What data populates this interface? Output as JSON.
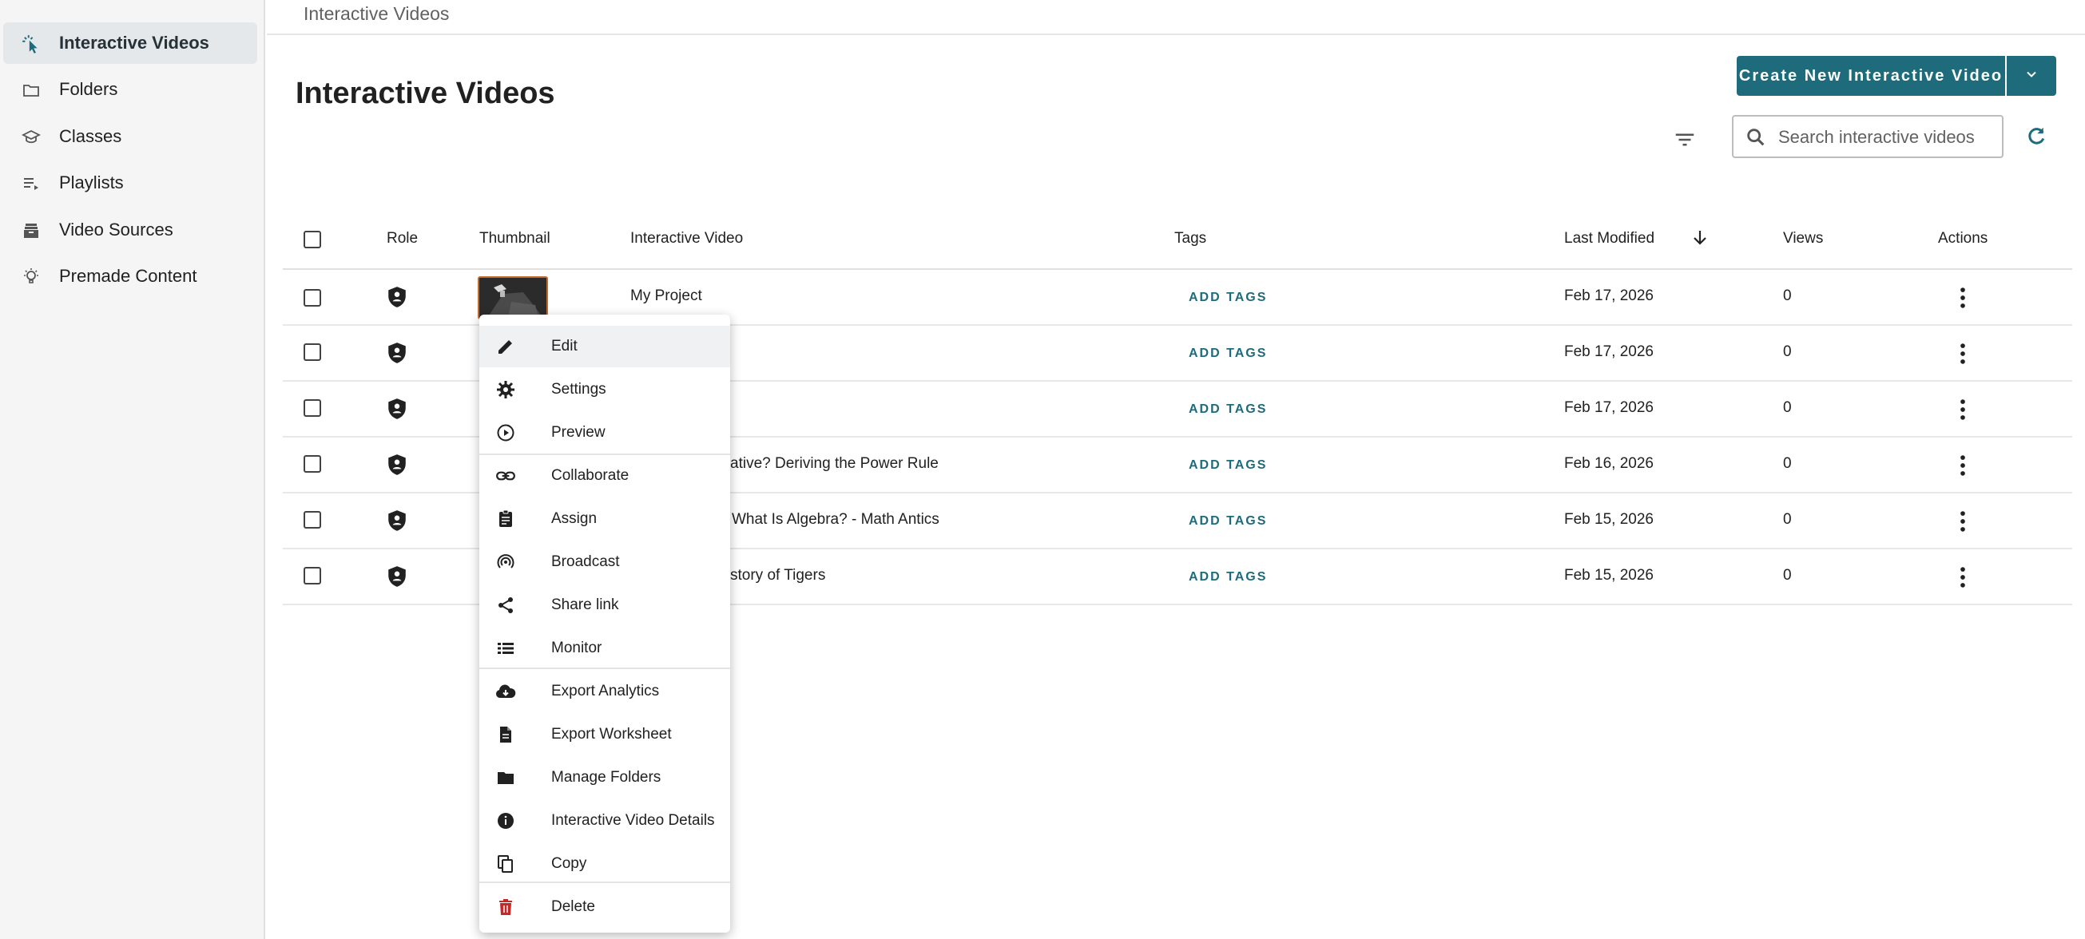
{
  "breadcrumb": "Interactive Videos",
  "page_title": "Interactive Videos",
  "sidebar": {
    "items": [
      {
        "label": "Interactive Videos",
        "icon": "pointer-click-icon",
        "active": true
      },
      {
        "label": "Folders",
        "icon": "folder-outline-icon"
      },
      {
        "label": "Classes",
        "icon": "school-icon"
      },
      {
        "label": "Playlists",
        "icon": "playlist-icon"
      },
      {
        "label": "Video Sources",
        "icon": "inbox-stack-icon"
      },
      {
        "label": "Premade Content",
        "icon": "lightbulb-icon"
      }
    ]
  },
  "toolbar": {
    "create_label": "Create New Interactive Video",
    "search_placeholder": "Search interactive videos"
  },
  "table": {
    "headers": {
      "role": "Role",
      "thumbnail": "Thumbnail",
      "video": "Interactive Video",
      "tags": "Tags",
      "modified": "Last Modified",
      "views": "Views",
      "actions": "Actions"
    },
    "rows": [
      {
        "title": "My Project",
        "tags": "ADD TAGS",
        "modified": "Feb 17, 2026",
        "views": "0"
      },
      {
        "title": "",
        "tags": "ADD TAGS",
        "modified": "Feb 17, 2026",
        "views": "0"
      },
      {
        "title": "",
        "tags": "ADD TAGS",
        "modified": "Feb 17, 2026",
        "views": "0"
      },
      {
        "title": "ative? Deriving the Power Rule",
        "tags": "ADD TAGS",
        "modified": "Feb 16, 2026",
        "views": "0"
      },
      {
        "title": "What Is Algebra? - Math Antics",
        "tags": "ADD TAGS",
        "modified": "Feb 15, 2026",
        "views": "0"
      },
      {
        "title": "story of Tigers",
        "tags": "ADD TAGS",
        "modified": "Feb 15, 2026",
        "views": "0"
      }
    ]
  },
  "context_menu": {
    "items": [
      {
        "label": "Edit",
        "icon": "pencil-icon"
      },
      {
        "label": "Settings",
        "icon": "gear-icon"
      },
      {
        "label": "Preview",
        "icon": "play-circle-icon"
      },
      {
        "label": "Collaborate",
        "icon": "link-icon"
      },
      {
        "label": "Assign",
        "icon": "clipboard-icon"
      },
      {
        "label": "Broadcast",
        "icon": "broadcast-icon"
      },
      {
        "label": "Share link",
        "icon": "share-icon"
      },
      {
        "label": "Monitor",
        "icon": "list-icon"
      },
      {
        "label": "Export Analytics",
        "icon": "cloud-download-icon"
      },
      {
        "label": "Export Worksheet",
        "icon": "document-icon"
      },
      {
        "label": "Manage Folders",
        "icon": "folder-icon"
      },
      {
        "label": "Interactive Video Details",
        "icon": "info-icon"
      },
      {
        "label": "Copy",
        "icon": "copy-icon"
      },
      {
        "label": "Delete",
        "icon": "trash-icon"
      }
    ]
  },
  "colors": {
    "accent": "#1e6b7b",
    "delete": "#c62828",
    "sidebar_bg": "#f5f5f5"
  }
}
